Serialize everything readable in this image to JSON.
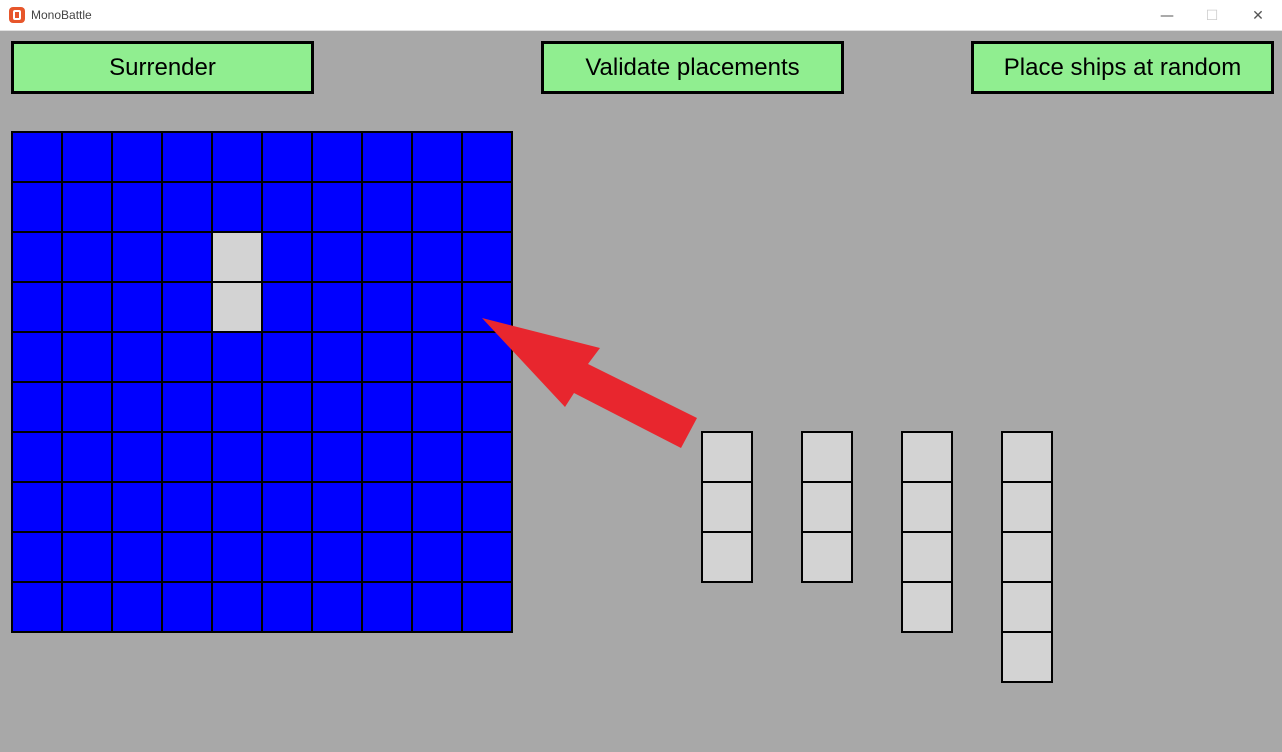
{
  "window": {
    "title": "MonoBattle",
    "minimize_glyph": "—",
    "maximize_glyph": "☐",
    "close_glyph": "✕"
  },
  "toolbar": {
    "surrender_label": "Surrender",
    "validate_label": "Validate placements",
    "random_label": "Place ships at random"
  },
  "colors": {
    "background": "#a8a8a8",
    "button": "#90ee90",
    "water": "#0000ff",
    "ship": "#d3d3d3",
    "arrow": "#e8262e"
  },
  "board": {
    "rows": 10,
    "cols": 10,
    "placed_ships": [
      {
        "cells": [
          [
            2,
            4
          ],
          [
            3,
            4
          ]
        ]
      }
    ]
  },
  "unplaced_ships": [
    {
      "length": 3
    },
    {
      "length": 3
    },
    {
      "length": 4
    },
    {
      "length": 5
    }
  ]
}
